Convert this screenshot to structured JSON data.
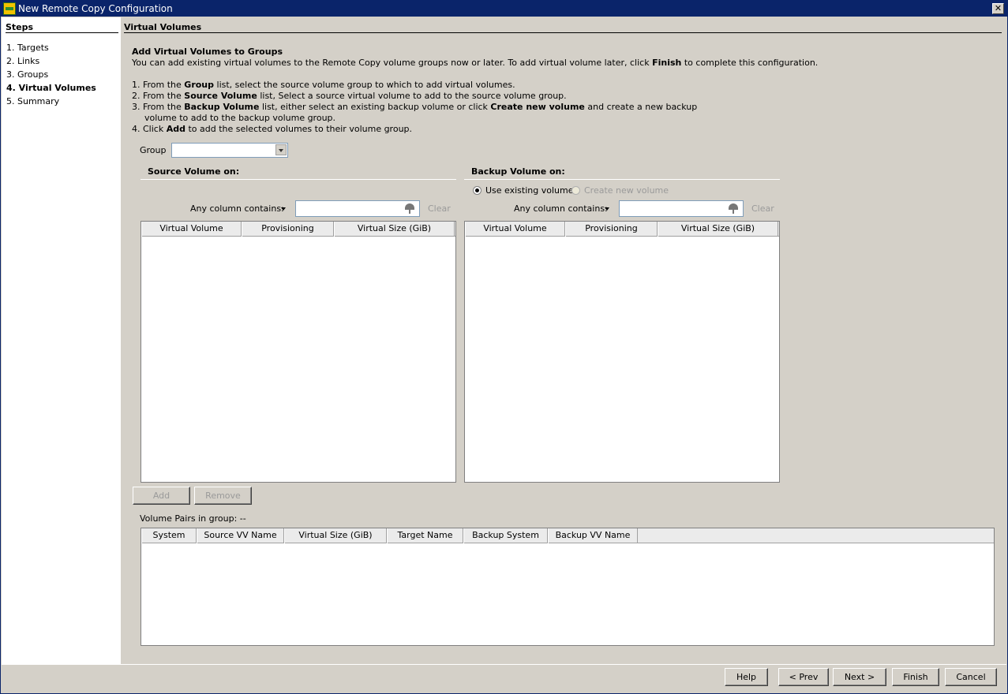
{
  "window": {
    "title": "New Remote Copy Configuration",
    "close_glyph": "✕"
  },
  "steps": {
    "title": "Steps",
    "items": [
      {
        "label": "1. Targets",
        "active": false
      },
      {
        "label": "2. Links",
        "active": false
      },
      {
        "label": "3. Groups",
        "active": false
      },
      {
        "label": "4. Virtual Volumes",
        "active": true
      },
      {
        "label": "5. Summary",
        "active": false
      }
    ]
  },
  "section": {
    "title": "Virtual Volumes",
    "intro_title": "Add Virtual Volumes to Groups",
    "intro_text": {
      "prefix": "You can add existing virtual volumes to the Remote Copy volume groups now or later. To add virtual volume later, click ",
      "bold": "Finish",
      "suffix": " to complete this configuration."
    },
    "instructions": [
      {
        "prefix": "1. From the ",
        "bold": "Group",
        "suffix": " list, select the source volume group to which to add virtual volumes."
      },
      {
        "prefix": "2. From the ",
        "bold": "Source Volume",
        "suffix": " list, Select a source virtual volume to add to the source volume group."
      },
      {
        "prefix": "3. From the ",
        "bold": "Backup Volume",
        "mid": " list, either select an existing backup volume or click ",
        "bold2": "Create new volume",
        "suffix": " and create a new backup"
      },
      {
        "text": "volume to add to the backup volume group."
      },
      {
        "prefix": "4. Click ",
        "bold": "Add",
        "suffix": " to add the selected volumes to their volume group."
      }
    ]
  },
  "group_field": {
    "label": "Group",
    "value": ""
  },
  "source": {
    "heading": "Source Volume on:",
    "filter_label": "Any column contains:",
    "filter_value": "",
    "clear_label": "Clear",
    "columns": [
      "Virtual Volume",
      "Provisioning",
      "Virtual Size (GiB)"
    ]
  },
  "backup": {
    "heading": "Backup Volume on:",
    "radio_existing": "Use existing volume",
    "radio_new": "Create new volume",
    "filter_label": "Any column contains:",
    "filter_value": "",
    "clear_label": "Clear",
    "columns": [
      "Virtual Volume",
      "Provisioning",
      "Virtual Size (GiB)"
    ]
  },
  "actions": {
    "add": "Add",
    "remove": "Remove"
  },
  "pairs": {
    "label": "Volume Pairs in group: --",
    "columns": [
      "System",
      "Source VV Name",
      "Virtual Size (GiB)",
      "Target Name",
      "Backup System",
      "Backup VV Name"
    ]
  },
  "footer": {
    "help": "Help",
    "prev": "< Prev",
    "next": "Next >",
    "finish": "Finish",
    "cancel": "Cancel"
  }
}
